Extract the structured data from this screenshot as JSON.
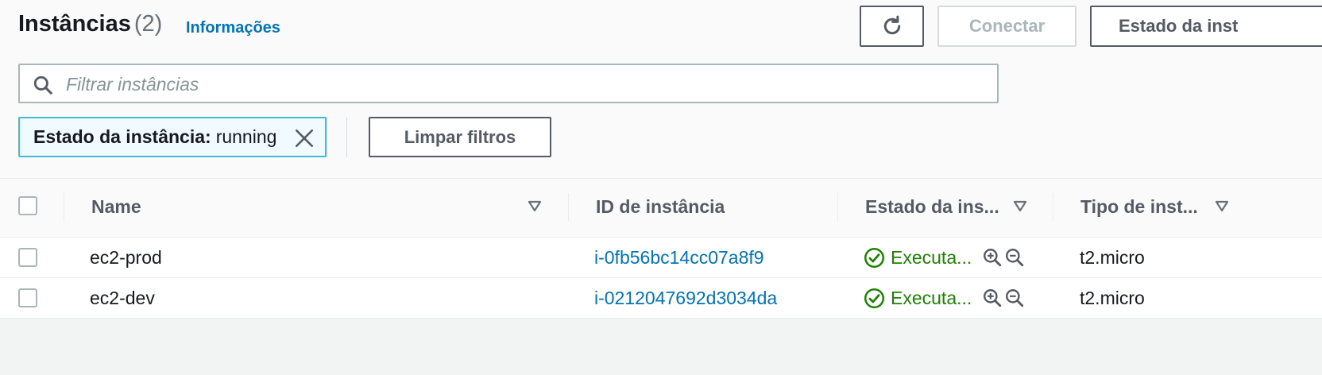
{
  "header": {
    "title": "Instâncias",
    "count": "(2)",
    "info_link": "Informações"
  },
  "toolbar": {
    "refresh_icon": "refresh-icon",
    "connect_label": "Conectar",
    "state_label": "Estado da inst"
  },
  "search": {
    "placeholder": "Filtrar instâncias",
    "value": "",
    "icon": "search-icon"
  },
  "filter_token": {
    "key": "Estado da instância",
    "separator": ":",
    "value": "running",
    "dismiss_icon": "close-icon"
  },
  "clear_filters_label": "Limpar filtros",
  "table": {
    "columns": {
      "name": "Name",
      "id": "ID de instância",
      "state": "Estado da ins...",
      "type": "Tipo de inst..."
    },
    "rows": [
      {
        "name": "ec2-prod",
        "id": "i-0fb56bc14cc07a8f9",
        "state": "Executa...",
        "type": "t2.micro"
      },
      {
        "name": "ec2-dev",
        "id": "i-0212047692d3034da",
        "state": "Executa...",
        "type": "t2.micro"
      }
    ]
  },
  "colors": {
    "link": "#0073bb",
    "running": "#1d8102",
    "token_border": "#44b9d6",
    "border_dark": "#545b64"
  }
}
